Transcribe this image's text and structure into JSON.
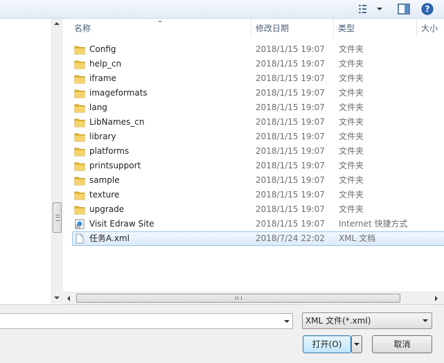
{
  "header": {
    "columns": [
      "名称",
      "修改日期",
      "类型",
      "大小"
    ]
  },
  "files": [
    {
      "name": "Config",
      "date": "2018/1/15 19:07",
      "type": "文件夹",
      "icon": "folder-icon"
    },
    {
      "name": "help_cn",
      "date": "2018/1/15 19:07",
      "type": "文件夹",
      "icon": "folder-icon"
    },
    {
      "name": "iframe",
      "date": "2018/1/15 19:07",
      "type": "文件夹",
      "icon": "folder-icon"
    },
    {
      "name": "imageformats",
      "date": "2018/1/15 19:07",
      "type": "文件夹",
      "icon": "folder-icon"
    },
    {
      "name": "lang",
      "date": "2018/1/15 19:07",
      "type": "文件夹",
      "icon": "folder-icon"
    },
    {
      "name": "LibNames_cn",
      "date": "2018/1/15 19:07",
      "type": "文件夹",
      "icon": "folder-icon"
    },
    {
      "name": "library",
      "date": "2018/1/15 19:07",
      "type": "文件夹",
      "icon": "folder-icon"
    },
    {
      "name": "platforms",
      "date": "2018/1/15 19:07",
      "type": "文件夹",
      "icon": "folder-icon"
    },
    {
      "name": "printsupport",
      "date": "2018/1/15 19:07",
      "type": "文件夹",
      "icon": "folder-icon"
    },
    {
      "name": "sample",
      "date": "2018/1/15 19:07",
      "type": "文件夹",
      "icon": "folder-icon"
    },
    {
      "name": "texture",
      "date": "2018/1/15 19:07",
      "type": "文件夹",
      "icon": "folder-icon"
    },
    {
      "name": "upgrade",
      "date": "2018/1/15 19:07",
      "type": "文件夹",
      "icon": "folder-icon"
    },
    {
      "name": "Visit Edraw Site",
      "date": "2018/1/15 19:07",
      "type": "Internet 快捷方式",
      "icon": "shortcut-icon"
    },
    {
      "name": "任务A.xml",
      "date": "2018/7/24 22:02",
      "type": "XML 文档",
      "icon": "document-icon",
      "selected": true
    }
  ],
  "footer": {
    "filename_value": "",
    "filter_label": "XML 文件(*.xml)",
    "open_label": "打开(O)",
    "cancel_label": "取消"
  },
  "colors": {
    "folder": "#e8b92f",
    "selection": "#dceafb",
    "accent": "#3c7fb1"
  }
}
